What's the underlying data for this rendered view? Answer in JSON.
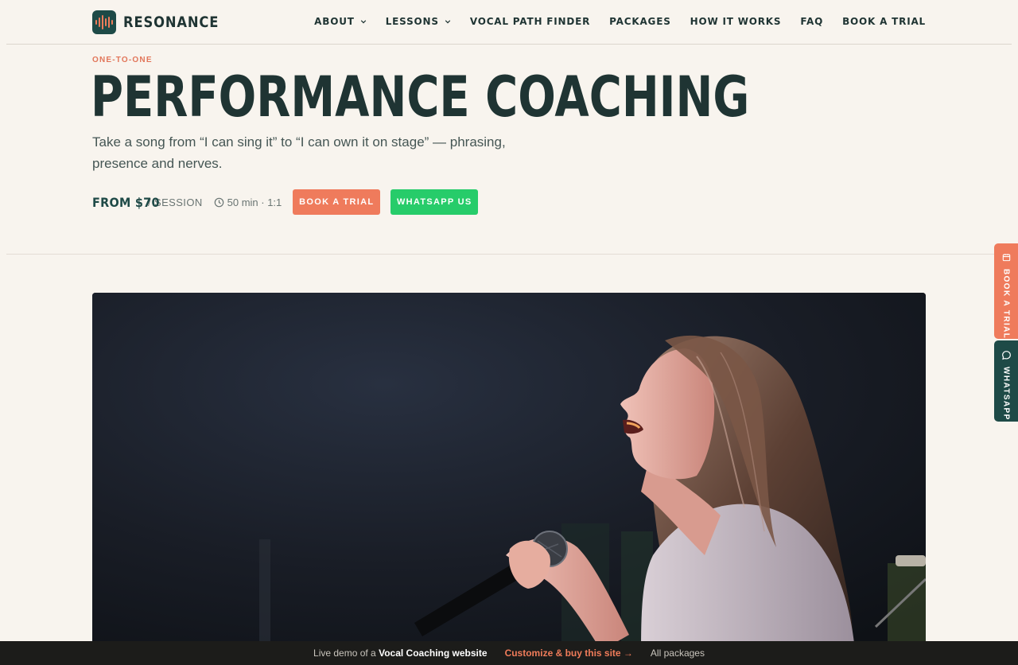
{
  "brand": {
    "name": "RESONANCE",
    "logo_icon": "waveform-icon"
  },
  "nav": [
    {
      "label": "ABOUT",
      "has_dropdown": true
    },
    {
      "label": "LESSONS",
      "has_dropdown": true
    },
    {
      "label": "VOCAL PATH FINDER",
      "has_dropdown": false
    },
    {
      "label": "PACKAGES",
      "has_dropdown": false
    },
    {
      "label": "HOW IT WORKS",
      "has_dropdown": false
    },
    {
      "label": "FAQ",
      "has_dropdown": false
    },
    {
      "label": "BOOK A TRIAL",
      "has_dropdown": false
    }
  ],
  "hero": {
    "eyebrow": "ONE-TO-ONE",
    "title": "PERFORMANCE COACHING",
    "lede": "Take a song from “I can sing it” to “I can own it on stage” — phrasing, presence and nerves.",
    "price": "FROM $70",
    "price_unit": "/ SESSION",
    "meta": "50 min · 1:1",
    "meta_icon": "clock-icon",
    "book_label": "BOOK A TRIAL",
    "whatsapp_label": "WHATSAPP US"
  },
  "side_tabs": {
    "book_label": "BOOK A TRIAL",
    "book_icon": "ticket-icon",
    "whatsapp_label": "WHATSAPP",
    "whatsapp_icon": "chat-bubble-icon"
  },
  "demo_bar": {
    "prefix": "Live demo of a",
    "site_type": "Vocal Coaching website",
    "cta": "Customize & buy this site →",
    "all": "All packages"
  },
  "colors": {
    "background": "#f8f4ee",
    "ink": "#1f3433",
    "accent": "#ef7b5c",
    "whatsapp": "#27cc6a",
    "teal": "#1e4a47"
  }
}
